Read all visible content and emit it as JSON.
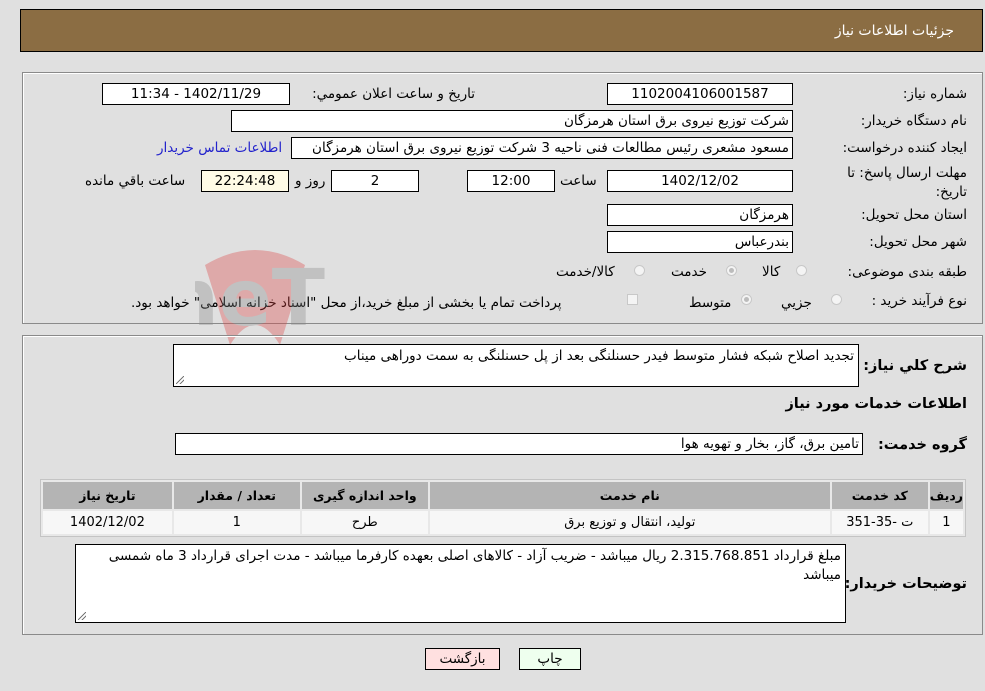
{
  "header": {
    "title": "جزئیات اطلاعات نیاز"
  },
  "form": {
    "need_number": {
      "label": "شماره نیاز:",
      "value": "1102004106001587"
    },
    "announce_datetime": {
      "label": "تاریخ و ساعت اعلان عمومي:",
      "value": "1402/11/29 - 11:34"
    },
    "buyer_org": {
      "label": "نام دستگاه خريدار:",
      "value": "شرکت توزیع نیروی برق استان هرمزگان"
    },
    "requester": {
      "label": "ايجاد کننده درخواست:",
      "value": "مسعود مشعری رئیس مطالعات فنی ناحیه 3 شرکت توزیع نیروی برق استان هرمزگان"
    },
    "buyer_contact_link": "اطلاعات تماس خريدار",
    "deadline": {
      "label": "مهلت ارسال پاسخ: تا تاریخ:",
      "date": "1402/12/02",
      "time_label": "ساعت",
      "time": "12:00",
      "days": "2",
      "days_label": "روز و",
      "remaining": "22:24:48",
      "remaining_label": "ساعت باقي مانده"
    },
    "province": {
      "label": "استان محل تحویل:",
      "value": "هرمزگان"
    },
    "city": {
      "label": "شهر محل تحویل:",
      "value": "بندرعباس"
    },
    "category": {
      "label": "طبقه بندی موضوعی:",
      "options": [
        "کالا",
        "خدمت",
        "کالا/خدمت"
      ],
      "selected": "خدمت"
    },
    "purchase_type": {
      "label": "نوع فرآیند خرید :",
      "options": [
        "جزيي",
        "متوسط"
      ],
      "selected": "متوسط",
      "treasury_note": "پرداخت تمام یا بخشی از مبلغ خرید،از محل \"اسناد خزانه اسلامی\" خواهد بود."
    }
  },
  "description": {
    "label": "شرح کلي نياز:",
    "value": "تجدید اصلاح شبکه فشار متوسط فیدر حسنلنگی بعد از پل حسنلنگی به سمت دوراهی میناب"
  },
  "services": {
    "section_title": "اطلاعات خدمات مورد نياز",
    "group_label": "گروه خدمت:",
    "group_value": "تامين برق، گاز، بخار و تهويه هوا",
    "table": {
      "headers": [
        "رديف",
        "کد خدمت",
        "نام خدمت",
        "واحد اندازه گيری",
        "تعداد / مقدار",
        "تاريخ نياز"
      ],
      "rows": [
        [
          "1",
          "ت -35-351",
          "تولید، انتقال و توزیع برق",
          "طرح",
          "1",
          "1402/12/02"
        ]
      ]
    }
  },
  "buyer_notes": {
    "label": "توضیحات خریدار:",
    "value": "مبلغ قرارداد  2.315.768.851 ریال میباشد - ضریب آزاد - کالاهای اصلی بعهده کارفرما میباشد - مدت اجرای قرارداد 3 ماه شمسی میباشد"
  },
  "buttons": {
    "print": "چاپ",
    "back": "بازگشت"
  },
  "watermark": "AriaTender.neT"
}
